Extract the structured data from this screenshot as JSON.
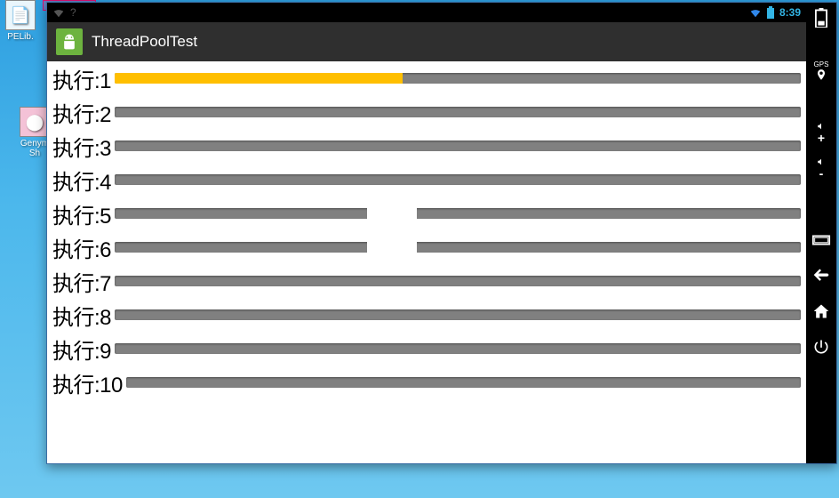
{
  "desktop": {
    "icons": [
      {
        "label": "Genym\nSh"
      },
      {
        "label": "PELib."
      }
    ]
  },
  "emulator": {
    "status": {
      "time": "8:39"
    },
    "action_bar": {
      "title": "ThreadPoolTest"
    },
    "rows": [
      {
        "label": "执行:1",
        "progress": 42
      },
      {
        "label": "执行:2",
        "progress": 0
      },
      {
        "label": "执行:3",
        "progress": 0
      },
      {
        "label": "执行:4",
        "progress": 0
      },
      {
        "label": "执行:5",
        "progress": 0
      },
      {
        "label": "执行:6",
        "progress": 0
      },
      {
        "label": "执行:7",
        "progress": 0
      },
      {
        "label": "执行:8",
        "progress": 0
      },
      {
        "label": "执行:9",
        "progress": 0
      },
      {
        "label": "执行:10",
        "progress": 0
      }
    ],
    "side_controls": [
      "battery",
      "gps",
      "volume-up",
      "volume-down",
      "rotate",
      "back",
      "home",
      "power"
    ]
  }
}
